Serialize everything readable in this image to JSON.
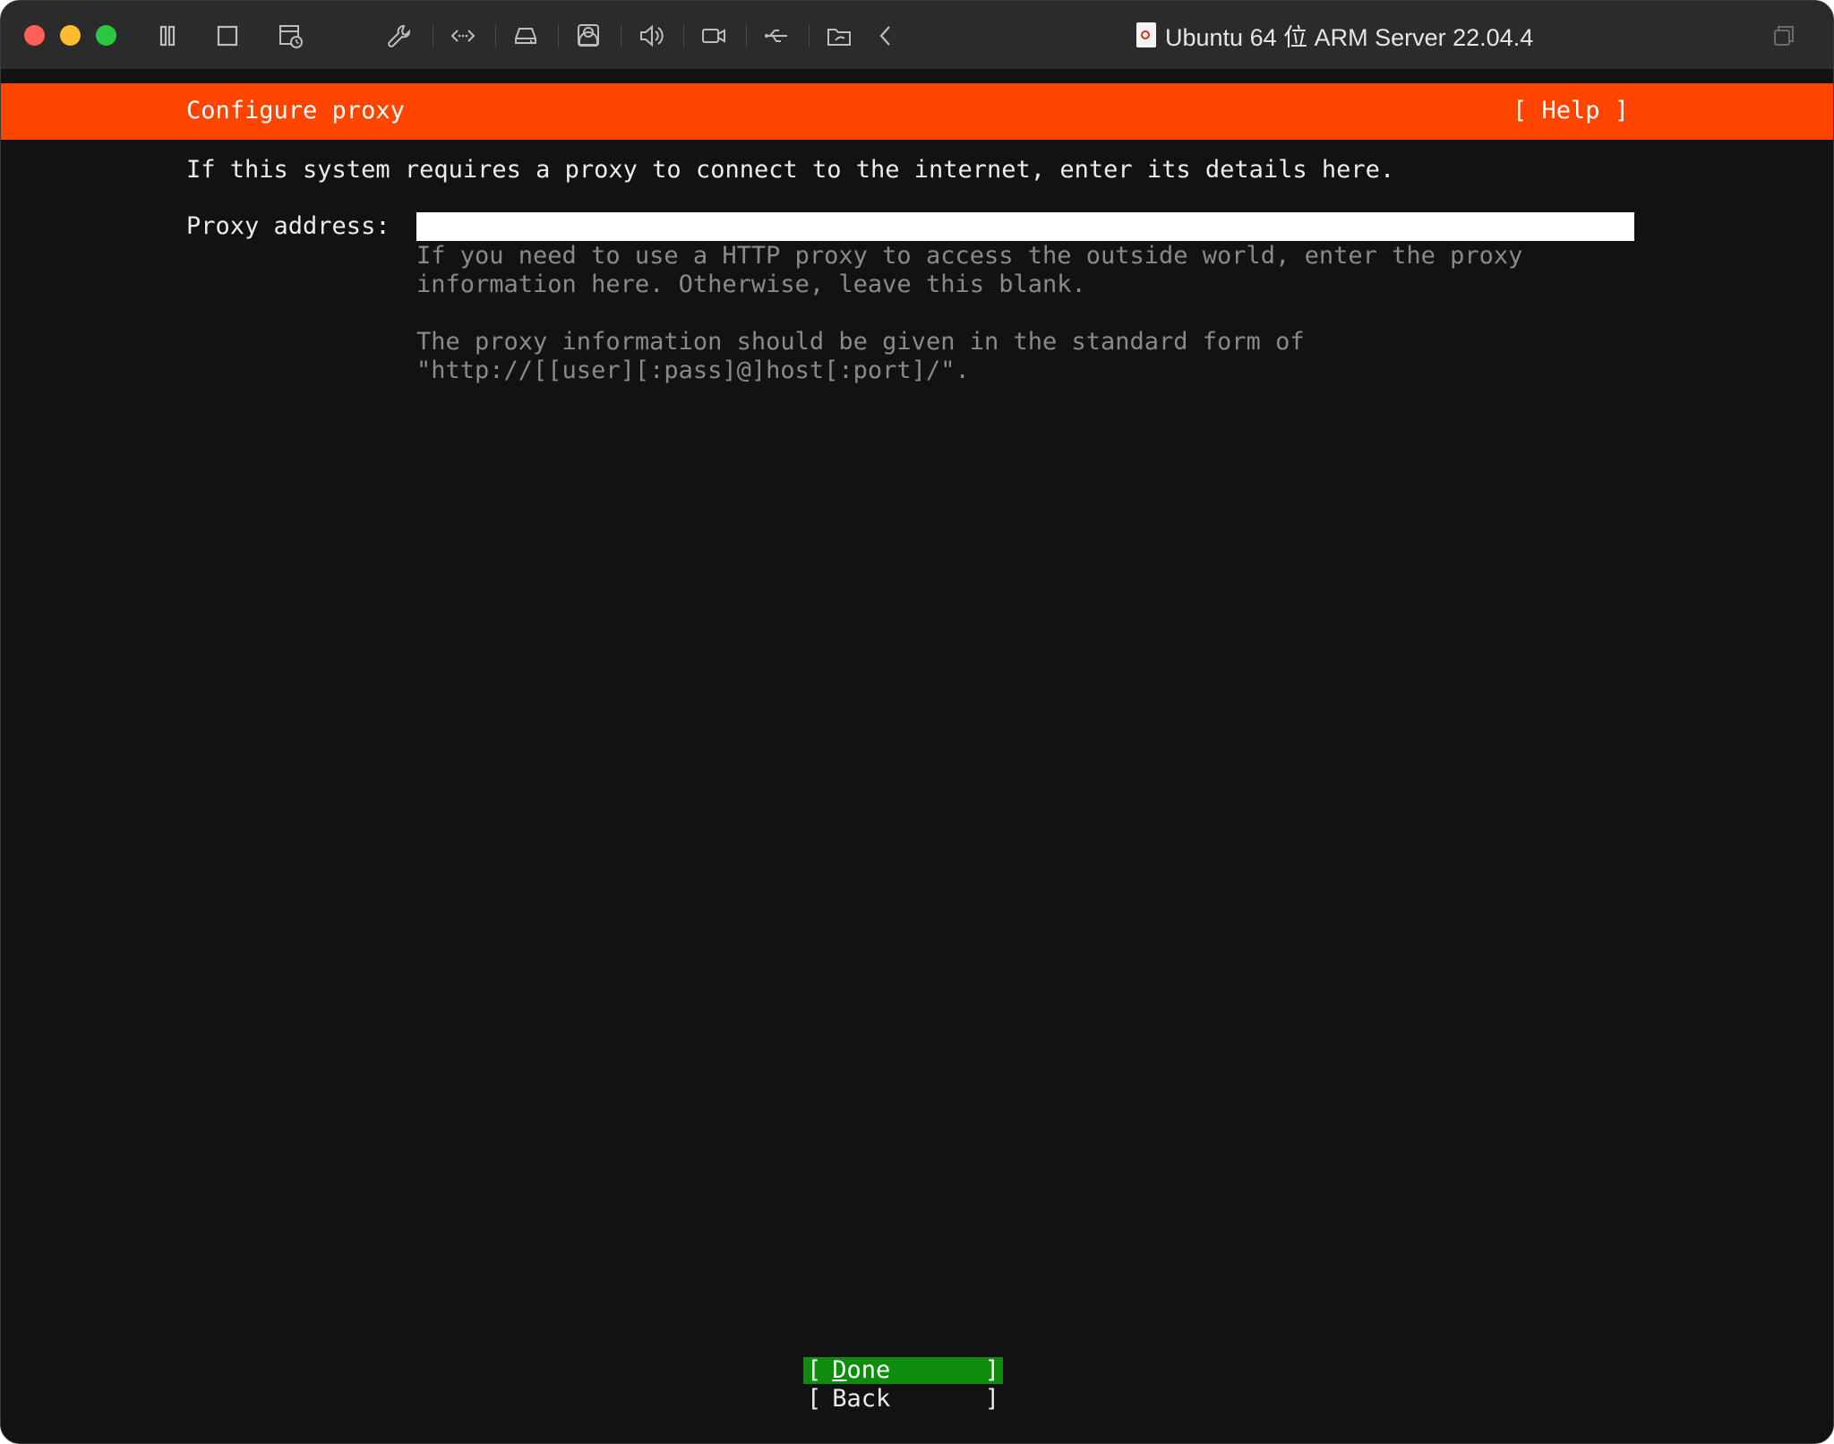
{
  "window": {
    "title": "Ubuntu 64 位 ARM Server 22.04.4",
    "toolbar_icons": [
      "pause-icon",
      "stop-icon",
      "snapshot-icon",
      "settings-wrench-icon",
      "code-icon",
      "disk-icon",
      "user-icon",
      "sound-icon",
      "camera-icon",
      "usb-icon",
      "shared-folder-icon",
      "back-chevron-icon"
    ]
  },
  "installer": {
    "header_title": "Configure proxy",
    "help_label": "[ Help ]",
    "intro": "If this system requires a proxy to connect to the internet, enter its details here.",
    "proxy_label": "Proxy address:",
    "proxy_value": "",
    "help_lines": [
      "If you need to use a HTTP proxy to access the outside world, enter the proxy",
      "information here. Otherwise, leave this blank.",
      "The proxy information should be given in the standard form of",
      "\"http://[[user][:pass]@]host[:port]/\"."
    ],
    "buttons": {
      "done_first": "D",
      "done_rest": "one",
      "back": "Back",
      "bracket_open": "[",
      "bracket_close": "]"
    },
    "colors": {
      "header": "#fe4500",
      "selected_button": "#0d8c0d",
      "background": "#121212"
    }
  }
}
